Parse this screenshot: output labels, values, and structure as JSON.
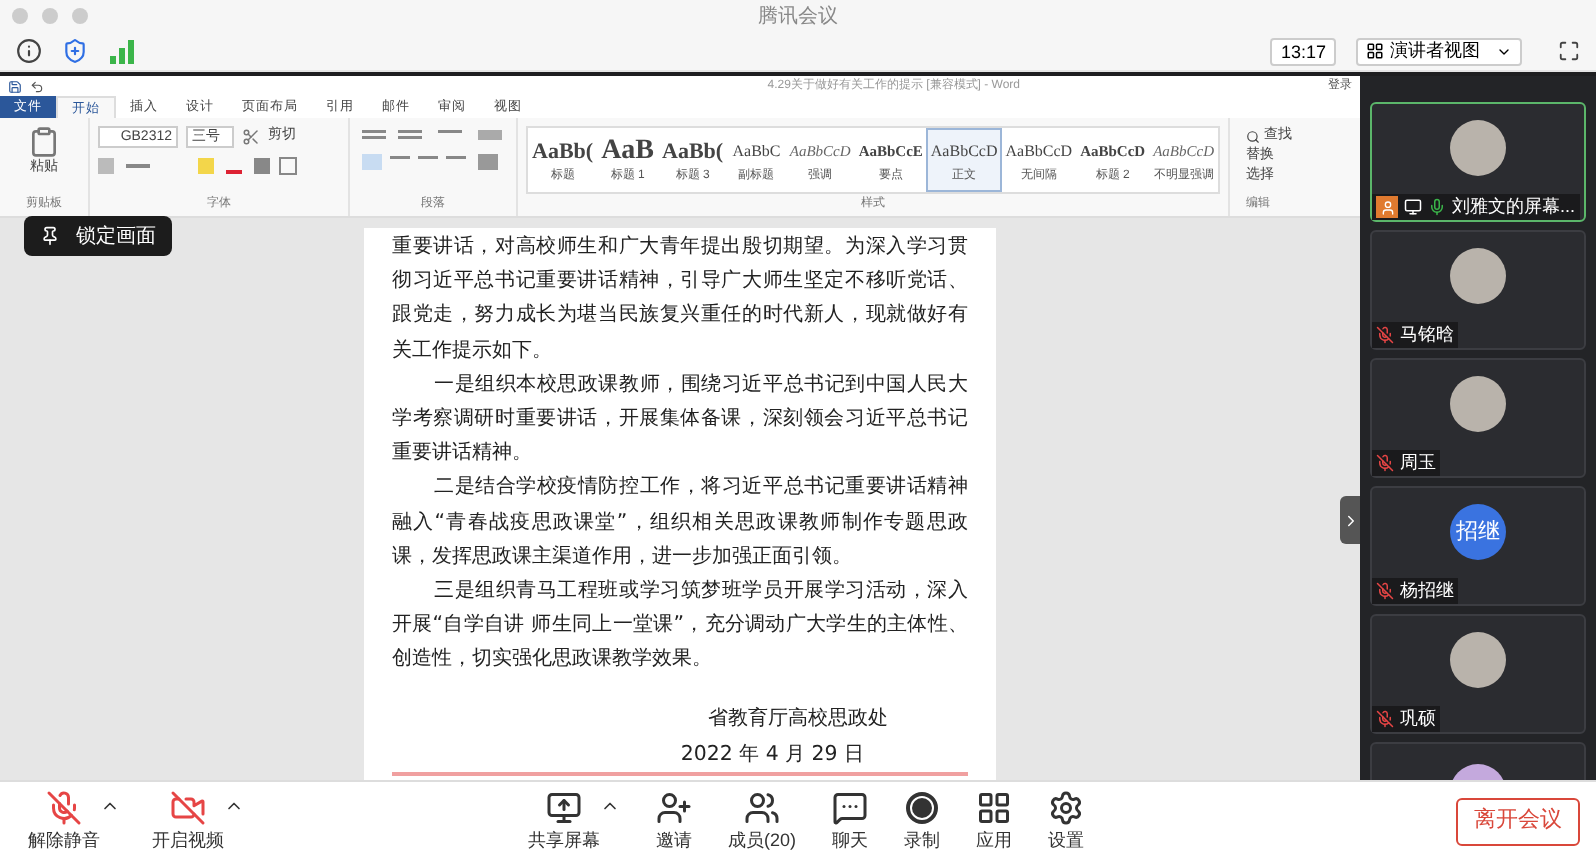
{
  "window": {
    "title": "腾讯会议"
  },
  "toolbar": {
    "time": "13:17",
    "view_button": "演讲者视图"
  },
  "word": {
    "title": "4.29关于做好有关工作的提示 [兼容模式] - Word",
    "sign_in": "登录",
    "tabs": [
      {
        "label": "文件",
        "kind": "file"
      },
      {
        "label": "开始",
        "selected": true,
        "kind": "tab"
      },
      {
        "label": "插入",
        "selected": false,
        "kind": "tab"
      },
      {
        "label": "设计",
        "selected": false,
        "kind": "tab"
      },
      {
        "label": "页面布局",
        "selected": false,
        "kind": "tab"
      },
      {
        "label": "引用",
        "selected": false,
        "kind": "tab"
      },
      {
        "label": "邮件",
        "selected": false,
        "kind": "tab"
      },
      {
        "label": "审阅",
        "selected": false,
        "kind": "tab"
      },
      {
        "label": "视图",
        "selected": false,
        "kind": "tab"
      }
    ],
    "clipboard": {
      "paste": "粘贴",
      "cut": "剪切"
    },
    "font": {
      "name": "GB2312",
      "size": "三号"
    },
    "styles": [
      {
        "sample": "AaBb(",
        "label": "标题",
        "kind": "heading",
        "selected": false
      },
      {
        "sample": "AaB",
        "label": "标题 1",
        "kind": "large",
        "selected": false
      },
      {
        "sample": "AaBb(",
        "label": "标题 3",
        "kind": "heading",
        "selected": false
      },
      {
        "sample": "AaBbC",
        "label": "副标题",
        "kind": "plain",
        "selected": false
      },
      {
        "sample": "AaBbCcD",
        "label": "强调",
        "kind": "italic",
        "selected": false
      },
      {
        "sample": "AaBbCcE",
        "label": "要点",
        "kind": "bold",
        "selected": false
      },
      {
        "sample": "AaBbCcD",
        "label": "正文",
        "kind": "plain",
        "selected": true
      },
      {
        "sample": "AaBbCcD",
        "label": "无间隔",
        "kind": "plain",
        "selected": false
      },
      {
        "sample": "AaBbCcD",
        "label": "标题 2",
        "kind": "bold",
        "selected": false
      },
      {
        "sample": "AaBbCcD",
        "label": "不明显强调",
        "kind": "italic",
        "selected": false
      }
    ],
    "edit": [
      "查找",
      "替换",
      "选择"
    ],
    "group_labels": [
      "剪贴板",
      "字体",
      "段落",
      "样式",
      "编辑"
    ],
    "document": {
      "paragraphs": [
        {
          "text": "重要讲话，对高校师生和广大青年提出殷切期望。为深入学习贯彻习近平总书记重要讲话精神，引导广大师生坚定不移听党话、跟党走，努力成长为堪当民族复兴重任的时代新人，现就做好有关工作提示如下。",
          "indent": false
        },
        {
          "text": "一是组织本校思政课教师，围绕习近平总书记到中国人民大学考察调研时重要讲话，开展集体备课，深刻领会习近平总书记重要讲话精神。",
          "indent": true
        },
        {
          "text": "二是结合学校疫情防控工作，将习近平总书记重要讲话精神融入“青春战疫思政课堂”，组织相关思政课教师制作专题思政课，发挥思政课主渠道作用，进一步加强正面引领。",
          "indent": true
        },
        {
          "text": "三是组织青马工程班或学习筑梦班学员开展学习活动，深入开展“自学自讲 师生同上一堂课”，充分调动广大学生的主体性、创造性，切实强化思政课教学效果。",
          "indent": true
        }
      ],
      "signature": [
        "省教育厅高校思政处",
        "2022 年 4 月 29 日"
      ]
    }
  },
  "lock_tooltip": "锁定画面",
  "participants": [
    {
      "name": "刘雅文的屏幕...",
      "avatar": {
        "kind": "photo"
      },
      "muted": false,
      "active": true,
      "host": true,
      "sharing": true
    },
    {
      "name": "马铭晗",
      "avatar": {
        "kind": "photo"
      },
      "muted": true,
      "active": false,
      "host": false,
      "sharing": false
    },
    {
      "name": "周玉",
      "avatar": {
        "kind": "photo"
      },
      "muted": true,
      "active": false,
      "host": false,
      "sharing": false
    },
    {
      "name": "杨招继",
      "avatar": {
        "kind": "text",
        "text": "招继",
        "color": "#3a73e0"
      },
      "muted": true,
      "active": false,
      "host": false,
      "sharing": false
    },
    {
      "name": "巩硕",
      "avatar": {
        "kind": "photo"
      },
      "muted": true,
      "active": false,
      "host": false,
      "sharing": false
    }
  ],
  "bottom_bar": {
    "buttons": [
      {
        "label": "解除静音",
        "kind": "mic-off",
        "menu": true
      },
      {
        "label": "开启视频",
        "kind": "video-off",
        "menu": true
      },
      {
        "label": "共享屏幕",
        "kind": "share",
        "menu": true
      },
      {
        "label": "邀请",
        "kind": "invite",
        "menu": false
      },
      {
        "label": "成员(20)",
        "kind": "members",
        "menu": false
      },
      {
        "label": "聊天",
        "kind": "chat",
        "menu": false
      },
      {
        "label": "录制",
        "kind": "record",
        "menu": false
      },
      {
        "label": "应用",
        "kind": "apps",
        "menu": false
      },
      {
        "label": "设置",
        "kind": "settings",
        "menu": false
      }
    ],
    "leave": "离开会议"
  }
}
